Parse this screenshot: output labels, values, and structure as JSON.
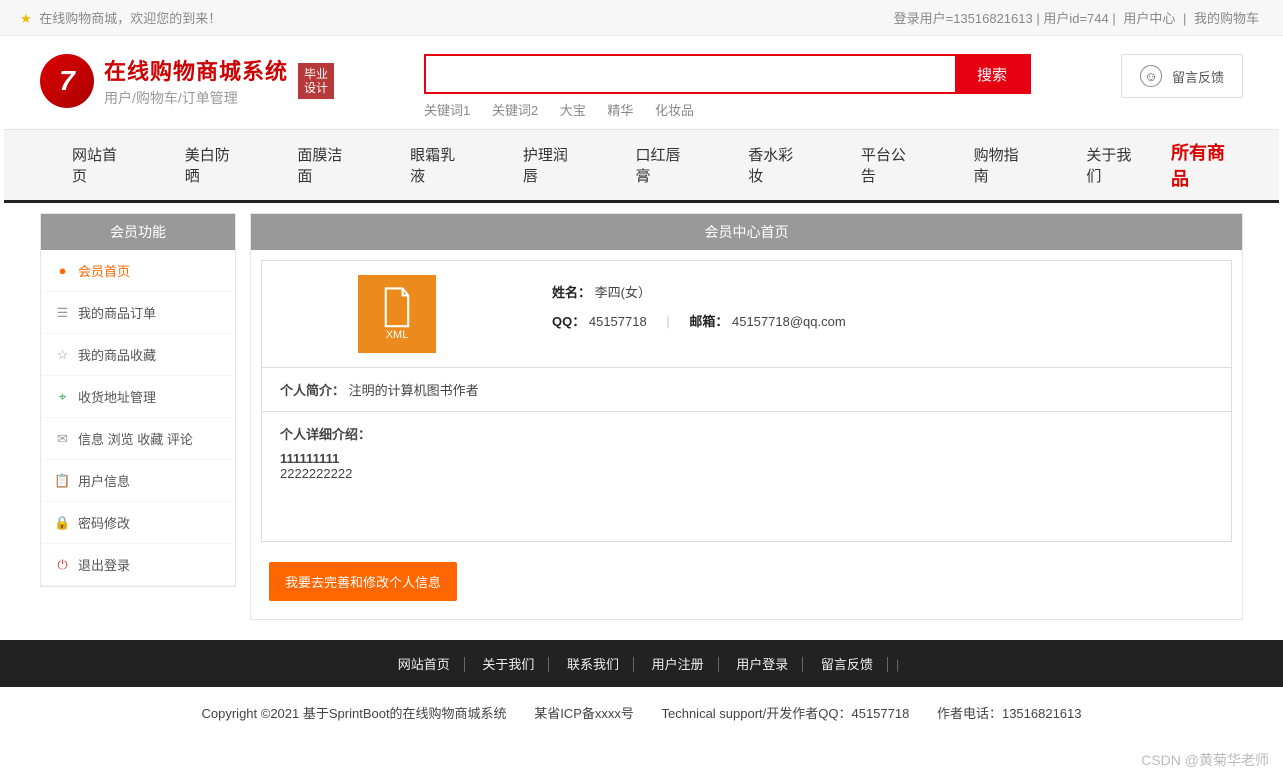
{
  "topbar": {
    "welcome": "在线购物商城，欢迎您的到来！",
    "login_user": "登录用户=13516821613",
    "user_id": "用户id=744",
    "user_center": "用户中心",
    "my_cart": "我的购物车"
  },
  "logo": {
    "title": "在线购物商城系统",
    "subtitle": "用户/购物车/订单管理",
    "badge_l1": "毕业",
    "badge_l2": "设计"
  },
  "search": {
    "placeholder": "",
    "button": "搜索",
    "keywords": [
      "关键词1",
      "关键词2",
      "大宝",
      "精华",
      "化妆品"
    ]
  },
  "feedback": "留言反馈",
  "nav": {
    "items": [
      "网站首页",
      "美白防晒",
      "面膜洁面",
      "眼霜乳液",
      "护理润唇",
      "口红唇膏",
      "香水彩妆",
      "平台公告",
      "购物指南",
      "关于我们"
    ],
    "all": "所有商品"
  },
  "sidebar": {
    "title": "会员功能",
    "items": [
      {
        "icon": "●",
        "label": "会员首页",
        "active": true,
        "name": "member-home"
      },
      {
        "icon": "☰",
        "label": "我的商品订单",
        "name": "my-orders"
      },
      {
        "icon": "☆",
        "label": "我的商品收藏",
        "name": "my-fav"
      },
      {
        "icon": "⌖",
        "label": "收货地址管理",
        "name": "address",
        "color": "#2aa54a"
      },
      {
        "icon": "✉",
        "label": "信息 浏览 收藏 评论",
        "name": "info-browse"
      },
      {
        "icon": "📋",
        "label": "用户信息",
        "name": "user-info",
        "color": "#3a9bd9"
      },
      {
        "icon": "🔒",
        "label": "密码修改",
        "name": "password",
        "color": "#e6a23c"
      },
      {
        "icon": "⏻",
        "label": "退出登录",
        "name": "logout",
        "color": "#d44"
      }
    ]
  },
  "content": {
    "title": "会员中心首页",
    "avatar_text": "XML",
    "name_label": "姓名：",
    "name_value": "李四(女）",
    "qq_label": "QQ：",
    "qq_value": "45157718",
    "email_label": "邮箱：",
    "email_value": "45157718@qq.com",
    "intro_label": "个人简介：",
    "intro_value": "注明的计算机图书作者",
    "detail_label": "个人详细介绍：",
    "detail_line1": "111111111",
    "detail_line2": "2222222222",
    "edit_btn": "我要去完善和修改个人信息"
  },
  "footer": {
    "links": [
      "网站首页",
      "关于我们",
      "联系我们",
      "用户注册",
      "用户登录",
      "留言反馈"
    ],
    "copyright": "Copyright ©2021 基于SprintBoot的在线购物商城系统",
    "icp": "某省ICP备xxxx号",
    "tech": "Technical support/开发作者QQ：45157718",
    "phone": "作者电话：13516821613"
  },
  "watermark": "CSDN @黄菊华老师"
}
